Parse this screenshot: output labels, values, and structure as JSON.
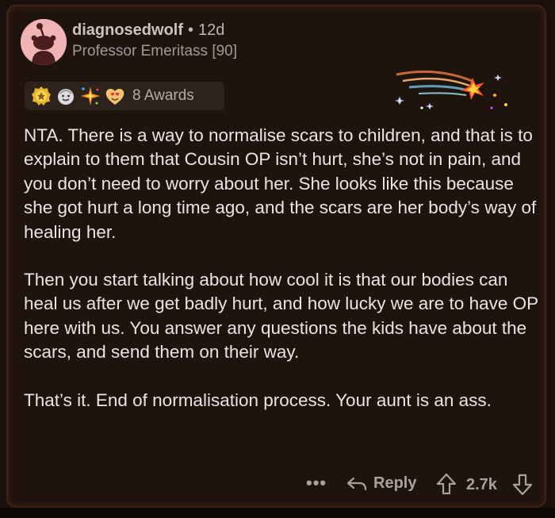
{
  "comment": {
    "username": "diagnosedwolf",
    "separator": "•",
    "age": "12d",
    "flair": "Professor Emeritass [90]",
    "awards": {
      "label": "8 Awards",
      "icons": [
        "star-badge-icon",
        "smiling-face-icon",
        "sparkle-burst-icon",
        "heart-eyes-icon"
      ]
    },
    "paragraphs": [
      "NTA.   There is a way to normalise scars to children, and that is to explain to them that Cousin OP isn’t hurt, she’s not in pain, and you don’t need to worry about her.   She looks like this because she got hurt a long time ago, and the scars are her body’s way of healing her.",
      "Then you start talking about how cool it is that our bodies can heal us after we get badly hurt, and how lucky we are to have OP here with us.   You answer any questions the kids have about the scars, and send them on their way.",
      "That’s it.   End of normalisation process.  Your aunt is an ass."
    ],
    "actions": {
      "more": "•••",
      "reply": "Reply",
      "score": "2.7k"
    }
  },
  "colors": {
    "background": "#1f130e",
    "border": "#3d2418",
    "text": "#e8e5e2",
    "muted": "#a8a29d",
    "avatar": "#f0b3b6"
  }
}
